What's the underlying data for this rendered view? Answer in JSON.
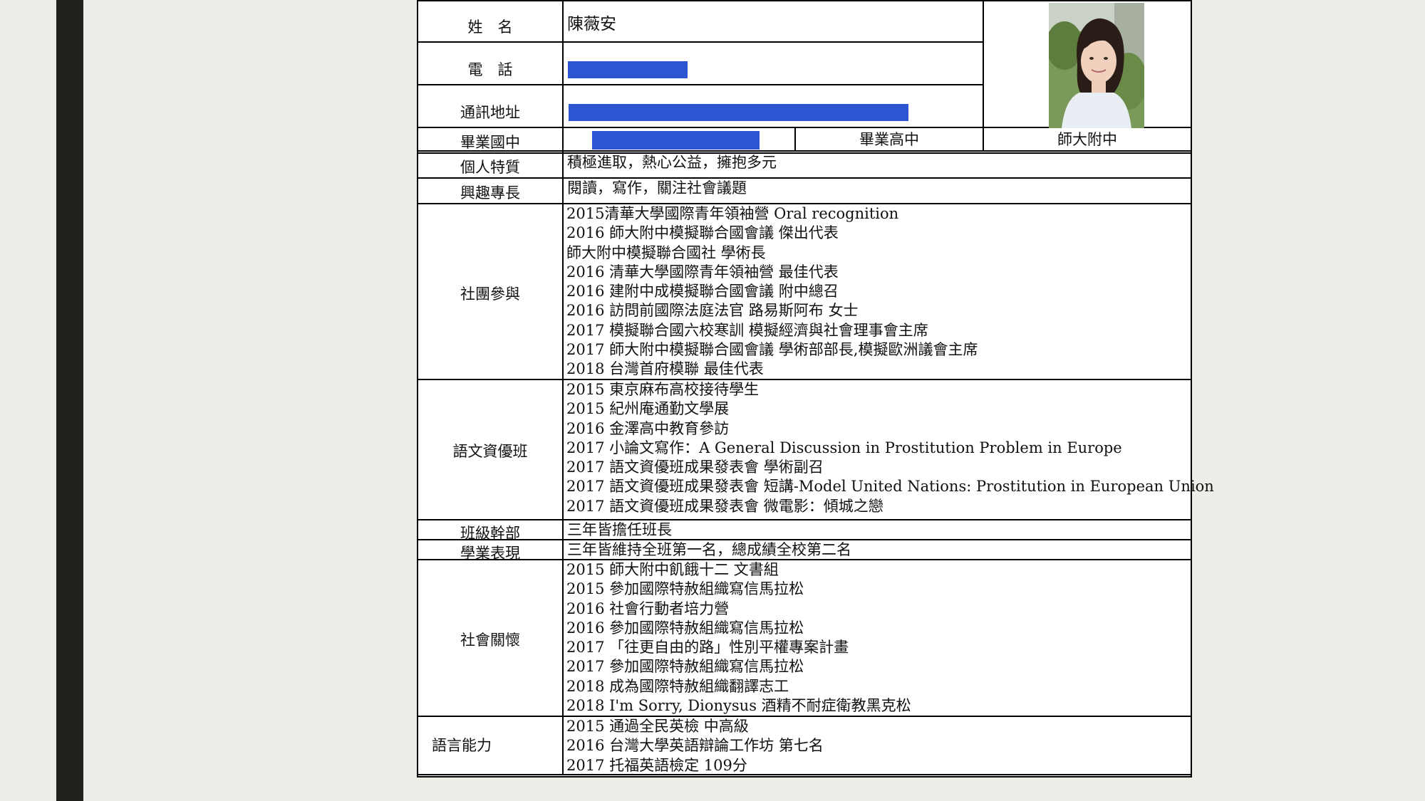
{
  "header": {
    "name_label": "姓　名",
    "name_value": "陳薇安",
    "phone_label": "電　話",
    "address_label": "通訊地址",
    "junior_high_label": "畢業國中",
    "senior_high_label": "畢業高中",
    "senior_high_value": "師大附中"
  },
  "rows": {
    "traits_label": "個人特質",
    "traits_value": "積極進取，熱心公益，擁抱多元",
    "interests_label": "興趣專長",
    "interests_value": "閱讀，寫作，關注社會議題",
    "clubs_label": "社團參與",
    "clubs": [
      "2015清華大學國際青年領袖營 Oral recognition",
      "2016 師大附中模擬聯合國會議 傑出代表",
      "師大附中模擬聯合國社 學術長",
      "2016 清華大學國際青年領袖營 最佳代表",
      "2016 建附中成模擬聯合國會議 附中總召",
      "2016 訪問前國際法庭法官 路易斯阿布 女士",
      "2017 模擬聯合國六校寒訓 模擬經濟與社會理事會主席",
      "2017 師大附中模擬聯合國會議 學術部部長,模擬歐洲議會主席",
      "2018 台灣首府模聯 最佳代表"
    ],
    "language_class_label": "語文資優班",
    "language_class": [
      "2015 東京麻布高校接待學生",
      "2015 紀州庵通勤文學展",
      "2016 金澤高中教育參訪",
      "2017 小論文寫作：A General Discussion in Prostitution Problem in Europe",
      "2017 語文資優班成果發表會 學術副召",
      "2017 語文資優班成果發表會 短講-Model United Nations: Prostitution in European Union",
      "2017 語文資優班成果發表會 微電影：傾城之戀"
    ],
    "cadre_label": "班級幹部",
    "cadre_value": "三年皆擔任班長",
    "academic_label": "學業表現",
    "academic_value": "三年皆維持全班第一名，總成績全校第二名",
    "social_label": "社會關懷",
    "social": [
      "2015 師大附中飢餓十二 文書組",
      "2015 參加國際特赦組織寫信馬拉松",
      "2016 社會行動者培力營",
      "2016 參加國際特赦組織寫信馬拉松",
      "2017 「往更自由的路」性別平權專案計畫",
      "2017 參加國際特赦組織寫信馬拉松",
      "2018 成為國際特赦組織翻譯志工",
      "2018 I'm Sorry, Dionysus 酒精不耐症衛教黑克松"
    ],
    "lang_ability_label": "語言能力",
    "lang_ability": [
      "2015 通過全民英檢 中高級",
      "2016 台灣大學英語辯論工作坊 第七名",
      "2017 托福英語檢定 109分"
    ]
  },
  "colors": {
    "redaction": "#2c55d3",
    "sidebar": "#23211d",
    "background": "#efede8"
  }
}
